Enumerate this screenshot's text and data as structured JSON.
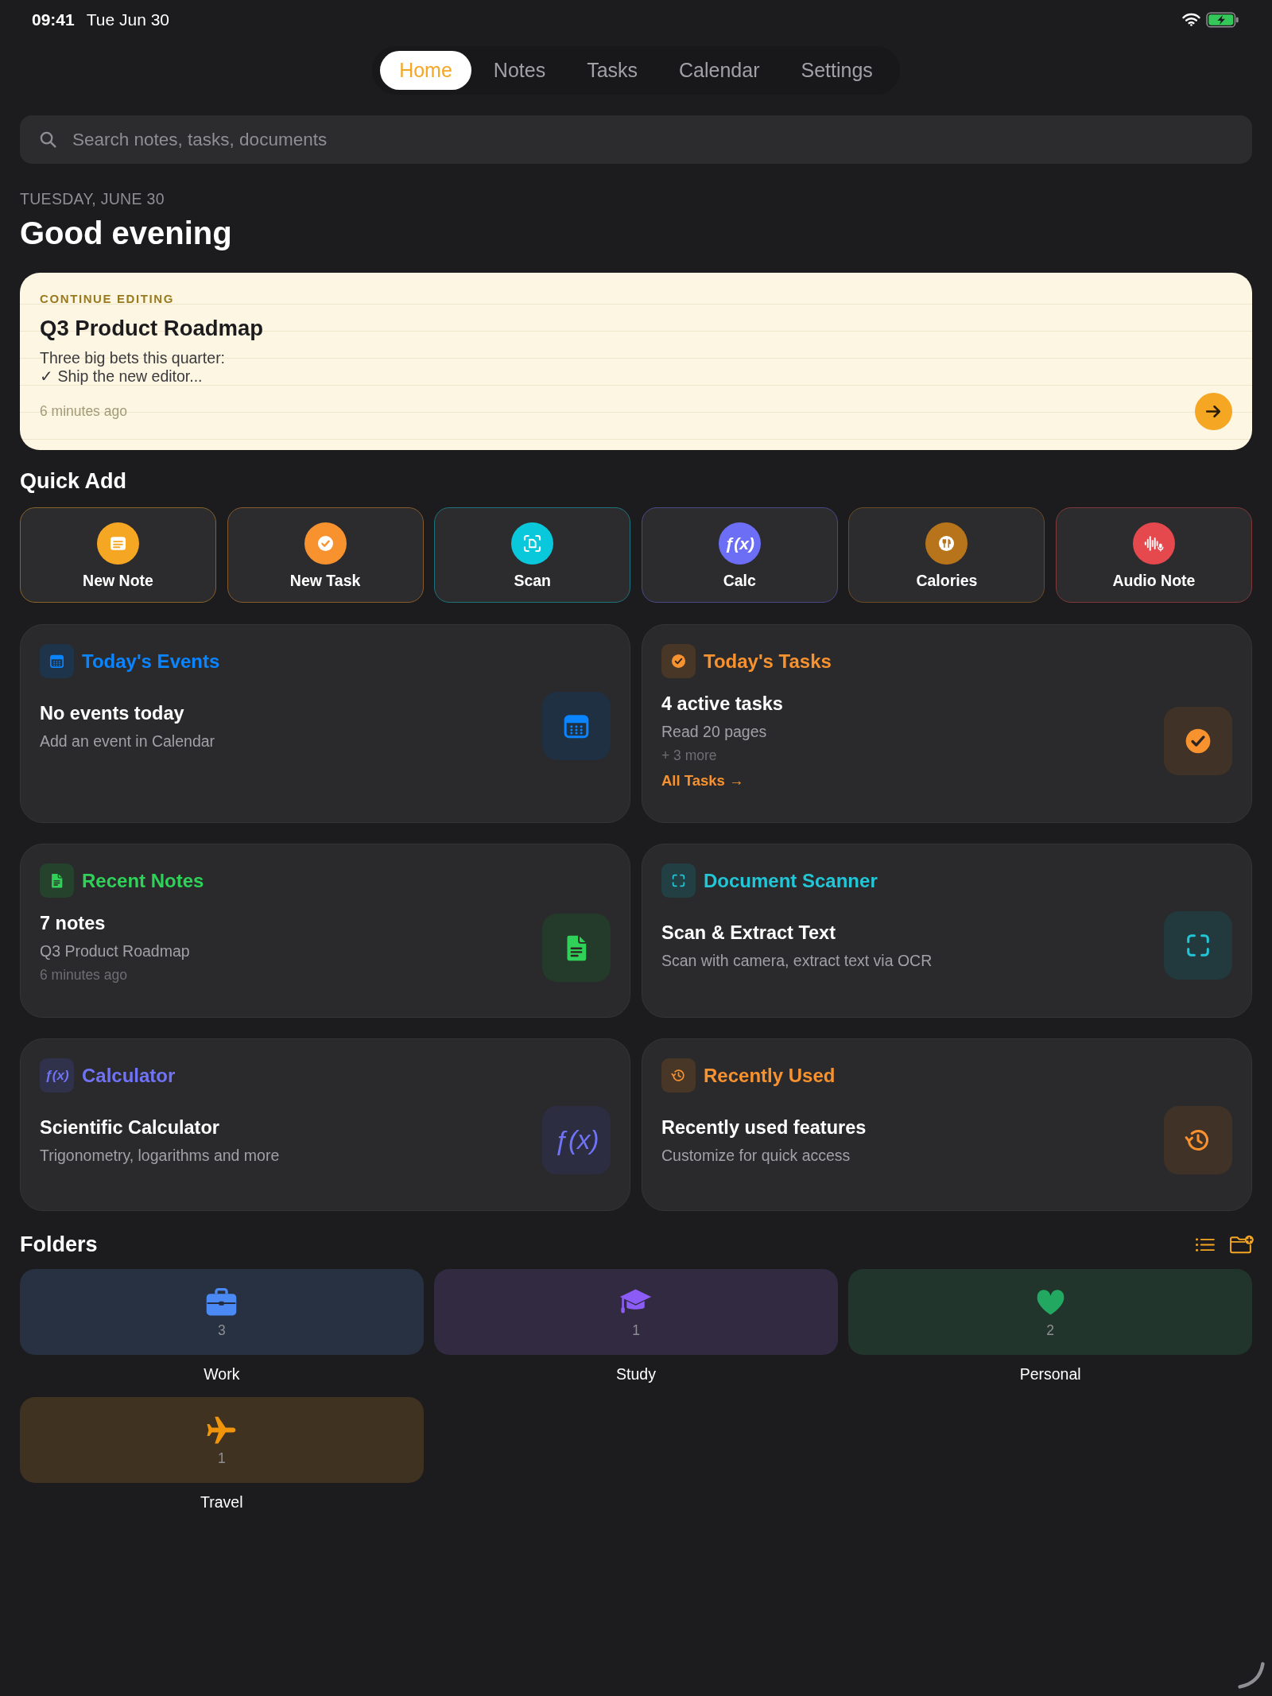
{
  "status_bar": {
    "time": "09:41",
    "date": "Tue Jun 30"
  },
  "tabs": [
    {
      "label": "Home",
      "selected": true
    },
    {
      "label": "Notes",
      "selected": false
    },
    {
      "label": "Tasks",
      "selected": false
    },
    {
      "label": "Calendar",
      "selected": false
    },
    {
      "label": "Settings",
      "selected": false
    }
  ],
  "search": {
    "placeholder": "Search notes, tasks, documents"
  },
  "greeting": {
    "date": "TUESDAY, JUNE 30",
    "title": "Good evening"
  },
  "continue_editing": {
    "label": "CONTINUE EDITING",
    "title": "Q3 Product Roadmap",
    "preview": "Three big bets this quarter:\n✓ Ship the new editor...",
    "time": "6 minutes ago"
  },
  "quick_add": {
    "title": "Quick Add",
    "items": [
      {
        "kind": "note",
        "label": "New Note",
        "color": "#f5a623"
      },
      {
        "kind": "task",
        "label": "New Task",
        "color": "#f7922f"
      },
      {
        "kind": "scan",
        "label": "Scan",
        "color": "#0ac8dc"
      },
      {
        "kind": "calc",
        "label": "Calc",
        "color": "#6c6ff6",
        "glyph": "ƒ(x)"
      },
      {
        "kind": "calories",
        "label": "Calories",
        "color": "#b8741a"
      },
      {
        "kind": "audio",
        "label": "Audio Note",
        "color": "#e5484d"
      }
    ]
  },
  "feature_cards": [
    {
      "kind": "events",
      "title": "Today's Events",
      "color": "#0a84ff",
      "headline": "No events today",
      "subtitle": "Add an event in Calendar"
    },
    {
      "kind": "tasks",
      "title": "Today's Tasks",
      "color": "#f7922f",
      "headline": "4 active tasks",
      "subtitle": "Read 20 pages",
      "note": "+ 3 more",
      "link": "All Tasks →"
    },
    {
      "kind": "notes",
      "title": "Recent Notes",
      "color": "#30d158",
      "headline": "7 notes",
      "subtitle": "Q3 Product Roadmap",
      "note": "6 minutes ago"
    },
    {
      "kind": "scanner",
      "title": "Document Scanner",
      "color": "#22c6d6",
      "headline": "Scan & Extract Text",
      "subtitle": "Scan with camera, extract text via OCR"
    },
    {
      "kind": "calculator",
      "title": "Calculator",
      "color": "#7073f5",
      "header_glyph": "ƒ(x)",
      "tile_glyph": "ƒ(x)",
      "headline": "Scientific Calculator",
      "subtitle": "Trigonometry, logarithms and more"
    },
    {
      "kind": "recent",
      "title": "Recently Used",
      "color": "#f7922f",
      "headline": "Recently used features",
      "subtitle": "Customize for quick access"
    }
  ],
  "folders": {
    "title": "Folders",
    "items": [
      {
        "kind": "work",
        "name": "Work",
        "count": "3",
        "color": "#4b8af5"
      },
      {
        "kind": "study",
        "name": "Study",
        "count": "1",
        "color": "#8b5cf6"
      },
      {
        "kind": "personal",
        "name": "Personal",
        "count": "2",
        "color": "#23a862"
      },
      {
        "kind": "travel",
        "name": "Travel",
        "count": "1",
        "color": "#f0940c"
      }
    ]
  }
}
